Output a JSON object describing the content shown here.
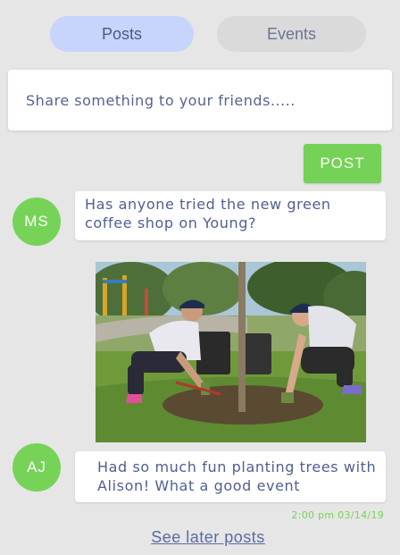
{
  "tabs": [
    {
      "label": "Posts",
      "active": true
    },
    {
      "label": "Events",
      "active": false
    }
  ],
  "composer": {
    "placeholder": "Share something to your friends.....",
    "post_label": "POST"
  },
  "feed": [
    {
      "initials": "MS",
      "text": "Has anyone tried the new green coffee shop on Young?"
    },
    {
      "initials": "AJ",
      "image": "photo of two volunteers planting a tree in a park",
      "text": "Had so much fun planting trees with Alison! What a good event",
      "timestamp": "2:00 pm 03/14/19"
    }
  ],
  "footer": {
    "see_later_label": "See later posts"
  },
  "colors": {
    "background": "#e6e6e6",
    "accent_green": "#74d256",
    "active_tab": "#c7d4fb",
    "inactive_tab": "#dadada",
    "text_blue": "#4f5f91"
  }
}
